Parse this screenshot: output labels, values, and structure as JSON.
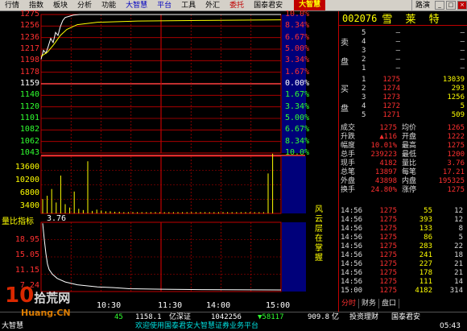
{
  "menu": {
    "items": [
      "行情",
      "指数",
      "板块",
      "分析",
      "功能",
      "大智慧",
      "平台",
      "工具",
      "外汇",
      "委托",
      "国泰君安"
    ],
    "brand": "大智慧",
    "route": "路演"
  },
  "stock": {
    "code": "002076",
    "name": "雪 莱 特"
  },
  "price_axis": {
    "left": [
      "1275",
      "1256",
      "1236",
      "1217",
      "1198",
      "1178",
      "1159",
      "1140",
      "1120",
      "1101",
      "1082",
      "1062",
      "1043"
    ],
    "right": [
      "10.0%",
      "8.34%",
      "6.67%",
      "5.00%",
      "3.34%",
      "1.67%",
      "0.00%",
      "1.67%",
      "3.34%",
      "5.00%",
      "6.67%",
      "8.34%",
      "10.0%"
    ]
  },
  "volume_axis": [
    "13600",
    "10200",
    "6800",
    "3400"
  ],
  "indicator": {
    "title": "量比指标",
    "value": "3.76",
    "axis": [
      "18.95",
      "15.05",
      "11.15",
      "7.24"
    ],
    "side_caption": "风云层在掌握"
  },
  "time_axis": [
    "10:30",
    "11:30",
    "14:00",
    "15:00"
  ],
  "orderbook": {
    "sell": [
      {
        "label": "5",
        "price": "—",
        "vol": "—"
      },
      {
        "label": "4",
        "price": "—",
        "vol": "—"
      },
      {
        "label": "3",
        "price": "—",
        "vol": "—"
      },
      {
        "label": "2",
        "price": "—",
        "vol": "—"
      },
      {
        "label": "1",
        "price": "—",
        "vol": "—"
      }
    ],
    "sell_char_top": "卖",
    "sell_char_bottom": "盘",
    "buy": [
      {
        "label": "1",
        "price": "1275",
        "vol": "13039"
      },
      {
        "label": "2",
        "price": "1274",
        "vol": "293"
      },
      {
        "label": "3",
        "price": "1273",
        "vol": "1256"
      },
      {
        "label": "4",
        "price": "1272",
        "vol": "5"
      },
      {
        "label": "5",
        "price": "1271",
        "vol": "509"
      }
    ],
    "buy_char_top": "买",
    "buy_char_bottom": "盘"
  },
  "stats": [
    {
      "k1": "成交",
      "v1": "1275",
      "k2": "均价",
      "v2": "1265"
    },
    {
      "k1": "升跌",
      "v1": "▲116",
      "k2": "开盘",
      "v2": "1222"
    },
    {
      "k1": "幅度",
      "v1": "10.01%",
      "k2": "最高",
      "v2": "1275"
    },
    {
      "k1": "总手",
      "v1": "239223",
      "k2": "最低",
      "v2": "1200"
    },
    {
      "k1": "现手",
      "v1": "4182",
      "k2": "量比",
      "v2": "3.76"
    },
    {
      "k1": "总笔",
      "v1": "13897",
      "k2": "每笔",
      "v2": "17.21"
    },
    {
      "k1": "外盘",
      "v1": "43898",
      "k2": "内盘",
      "v2": "195325"
    },
    {
      "k1": "换手",
      "v1": "24.80%",
      "k2": "涨停",
      "v2": "1275"
    }
  ],
  "ticks": [
    {
      "t": "14:56",
      "p": "1275",
      "v": "55",
      "n": "12"
    },
    {
      "t": "14:56",
      "p": "1275",
      "v": "393",
      "n": "12"
    },
    {
      "t": "14:56",
      "p": "1275",
      "v": "133",
      "n": "8"
    },
    {
      "t": "14:56",
      "p": "1275",
      "v": "86",
      "n": "5"
    },
    {
      "t": "14:56",
      "p": "1275",
      "v": "283",
      "n": "22"
    },
    {
      "t": "14:56",
      "p": "1275",
      "v": "241",
      "n": "18"
    },
    {
      "t": "14:56",
      "p": "1275",
      "v": "227",
      "n": "21"
    },
    {
      "t": "14:56",
      "p": "1275",
      "v": "178",
      "n": "21"
    },
    {
      "t": "14:56",
      "p": "1275",
      "v": "111",
      "n": "14"
    },
    {
      "t": "15:00",
      "p": "1275",
      "v": "4182",
      "n": "314"
    }
  ],
  "tabs": [
    "分时",
    "财务",
    "盘口"
  ],
  "status1": {
    "a": "45",
    "b": "1158.1",
    "c": "亿深证",
    "d": "1042256",
    "e": "▼58117",
    "f": "909.8",
    "g": "亿",
    "h": "投资理财",
    "i": "国泰君安"
  },
  "status2": {
    "left": "大智慧",
    "marquee": "欢迎使用国泰君安大智慧证券业务平台",
    "time": "05:43"
  },
  "watermark": "10 拾荒网 Huang.CN",
  "colors": {
    "up": "#ff3030",
    "down": "#30ff30",
    "grid": "#c00000",
    "accent": "#ffff00"
  }
}
